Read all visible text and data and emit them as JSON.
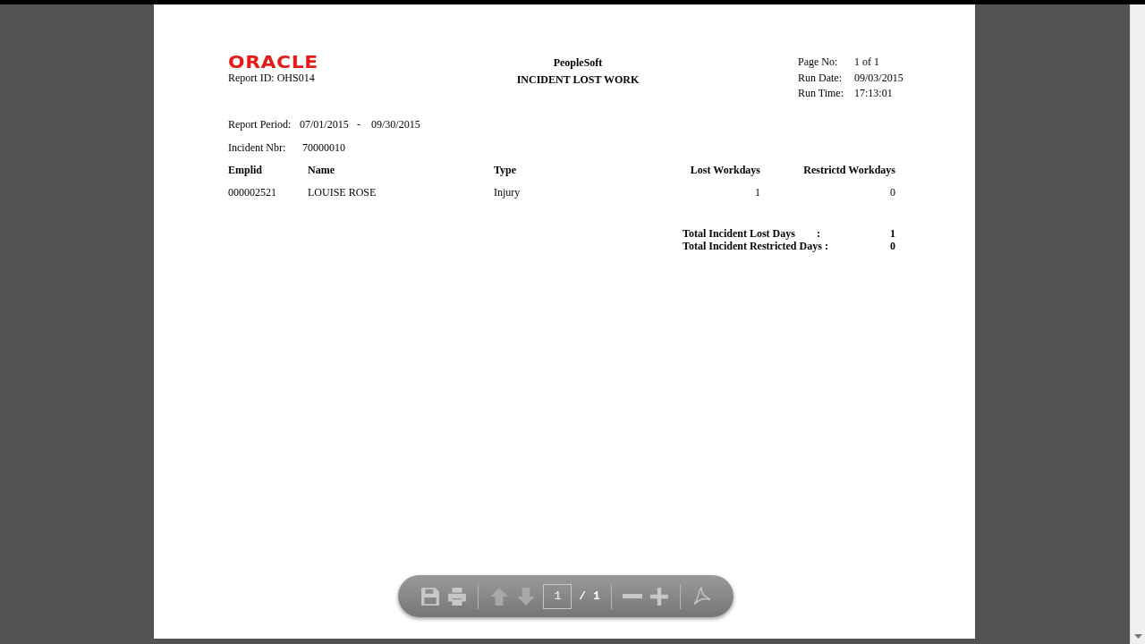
{
  "report": {
    "logo": "ORACLE",
    "report_id": "Report ID: OHS014",
    "app": "PeopleSoft",
    "title": "INCIDENT LOST WORK",
    "info": [
      {
        "label": "Page No:",
        "value": "1 of 1"
      },
      {
        "label": "Run Date:",
        "value": "09/03/2015"
      },
      {
        "label": "Run Time:",
        "value": "17:13:01"
      }
    ],
    "period": {
      "label": "Report Period:",
      "from": "07/01/2015",
      "separator": "-",
      "to": "09/30/2015"
    },
    "incident": {
      "label": "Incident Nbr:",
      "value": "70000010"
    },
    "table": {
      "columns": [
        "Emplid",
        "Name",
        "Type",
        "Lost Workdays",
        "Restrictd Workdays"
      ],
      "rows": [
        [
          "000002521",
          "LOUISE ROSE",
          "Injury",
          "1",
          "0"
        ]
      ]
    },
    "totals": [
      {
        "label": "Total Incident Lost Days",
        "colon": ":",
        "value": "1"
      },
      {
        "label": "Total Incident Restricted Days :",
        "value": "0"
      }
    ]
  },
  "toolbar": {
    "buttons": [
      {
        "kind": "save",
        "disabled": false
      },
      {
        "kind": "print",
        "disabled": false
      },
      {
        "kind": "sep"
      },
      {
        "kind": "up",
        "disabled": true
      },
      {
        "kind": "down",
        "disabled": true
      },
      {
        "kind": "page"
      },
      {
        "kind": "sep"
      },
      {
        "kind": "minus",
        "disabled": false
      },
      {
        "kind": "plus",
        "disabled": false
      },
      {
        "kind": "sep"
      },
      {
        "kind": "reader",
        "disabled": false
      }
    ],
    "page_value": "1",
    "page_total": "/ 1"
  }
}
